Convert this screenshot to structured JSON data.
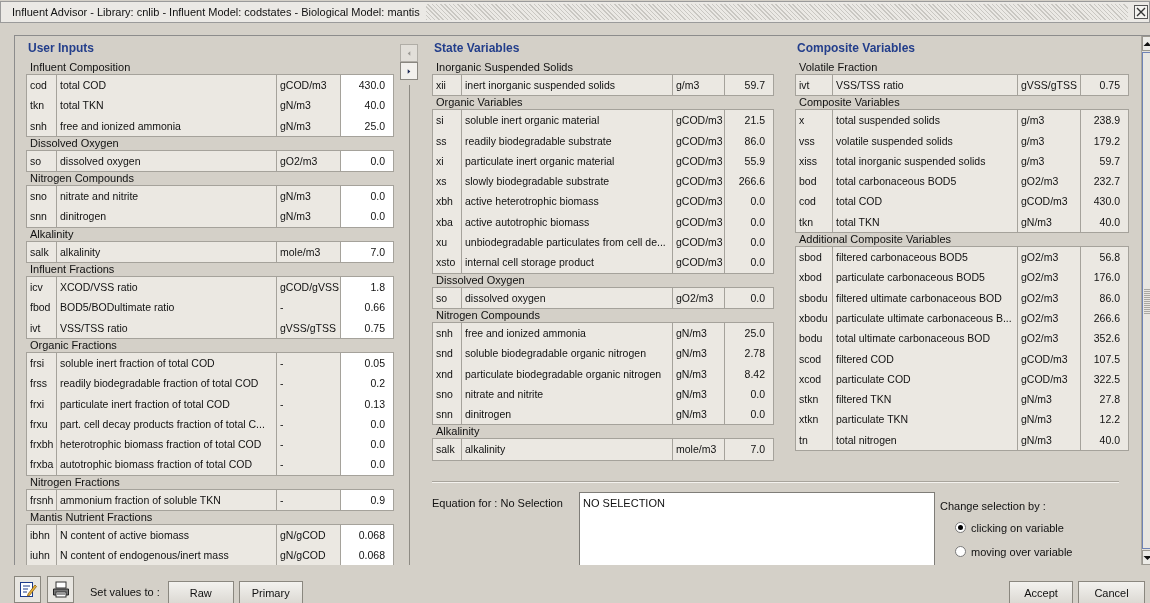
{
  "window": {
    "title": "Influent Advisor - Library: cnlib - Influent Model: codstates - Biological Model: mantis"
  },
  "user_inputs": {
    "title": "User Inputs",
    "editable": true,
    "groups": [
      {
        "title": "Influent Composition",
        "rows": [
          {
            "symbol": "cod",
            "description": "total COD",
            "unit": "gCOD/m3",
            "value": "430.0"
          },
          {
            "symbol": "tkn",
            "description": "total TKN",
            "unit": "gN/m3",
            "value": "40.0"
          },
          {
            "symbol": "snh",
            "description": "free and ionized ammonia",
            "unit": "gN/m3",
            "value": "25.0"
          }
        ]
      },
      {
        "title": "Dissolved Oxygen",
        "rows": [
          {
            "symbol": "so",
            "description": "dissolved oxygen",
            "unit": "gO2/m3",
            "value": "0.0"
          }
        ]
      },
      {
        "title": "Nitrogen Compounds",
        "rows": [
          {
            "symbol": "sno",
            "description": "nitrate and nitrite",
            "unit": "gN/m3",
            "value": "0.0"
          },
          {
            "symbol": "snn",
            "description": "dinitrogen",
            "unit": "gN/m3",
            "value": "0.0"
          }
        ]
      },
      {
        "title": "Alkalinity",
        "rows": [
          {
            "symbol": "salk",
            "description": "alkalinity",
            "unit": "mole/m3",
            "value": "7.0"
          }
        ]
      },
      {
        "title": "Influent Fractions",
        "rows": [
          {
            "symbol": "icv",
            "description": "XCOD/VSS ratio",
            "unit": "gCOD/gVSS",
            "value": "1.8"
          },
          {
            "symbol": "fbod",
            "description": "BOD5/BODultimate ratio",
            "unit": "-",
            "value": "0.66"
          },
          {
            "symbol": "ivt",
            "description": "VSS/TSS ratio",
            "unit": "gVSS/gTSS",
            "value": "0.75"
          }
        ]
      },
      {
        "title": "Organic Fractions",
        "rows": [
          {
            "symbol": "frsi",
            "description": "soluble inert fraction of total COD",
            "unit": "-",
            "value": "0.05"
          },
          {
            "symbol": "frss",
            "description": "readily biodegradable fraction of total COD",
            "unit": "-",
            "value": "0.2"
          },
          {
            "symbol": "frxi",
            "description": "particulate inert fraction of total COD",
            "unit": "-",
            "value": "0.13"
          },
          {
            "symbol": "frxu",
            "description": "part. cell decay products fraction of total C...",
            "unit": "-",
            "value": "0.0"
          },
          {
            "symbol": "frxbh",
            "description": "heterotrophic biomass fraction of total COD",
            "unit": "-",
            "value": "0.0"
          },
          {
            "symbol": "frxba",
            "description": "autotrophic biomass fraction of total COD",
            "unit": "-",
            "value": "0.0"
          }
        ]
      },
      {
        "title": "Nitrogen Fractions",
        "rows": [
          {
            "symbol": "frsnh",
            "description": "ammonium fraction of soluble TKN",
            "unit": "-",
            "value": "0.9"
          }
        ]
      },
      {
        "title": "Mantis Nutrient Fractions",
        "rows": [
          {
            "symbol": "ibhn",
            "description": "N content of active biomass",
            "unit": "gN/gCOD",
            "value": "0.068"
          },
          {
            "symbol": "iuhn",
            "description": "N content of endogenous/inert mass",
            "unit": "gN/gCOD",
            "value": "0.068"
          }
        ]
      }
    ]
  },
  "state_variables": {
    "title": "State Variables",
    "editable": false,
    "groups": [
      {
        "title": "Inorganic Suspended Solids",
        "rows": [
          {
            "symbol": "xii",
            "description": "inert inorganic suspended solids",
            "unit": "g/m3",
            "value": "59.7"
          }
        ]
      },
      {
        "title": "Organic Variables",
        "rows": [
          {
            "symbol": "si",
            "description": "soluble inert organic material",
            "unit": "gCOD/m3",
            "value": "21.5"
          },
          {
            "symbol": "ss",
            "description": "readily biodegradable substrate",
            "unit": "gCOD/m3",
            "value": "86.0"
          },
          {
            "symbol": "xi",
            "description": "particulate inert organic material",
            "unit": "gCOD/m3",
            "value": "55.9"
          },
          {
            "symbol": "xs",
            "description": "slowly biodegradable substrate",
            "unit": "gCOD/m3",
            "value": "266.6"
          },
          {
            "symbol": "xbh",
            "description": "active heterotrophic biomass",
            "unit": "gCOD/m3",
            "value": "0.0"
          },
          {
            "symbol": "xba",
            "description": "active autotrophic biomass",
            "unit": "gCOD/m3",
            "value": "0.0"
          },
          {
            "symbol": "xu",
            "description": "unbiodegradable particulates from cell de...",
            "unit": "gCOD/m3",
            "value": "0.0"
          },
          {
            "symbol": "xsto",
            "description": "internal cell storage product",
            "unit": "gCOD/m3",
            "value": "0.0"
          }
        ]
      },
      {
        "title": "Dissolved Oxygen",
        "rows": [
          {
            "symbol": "so",
            "description": "dissolved oxygen",
            "unit": "gO2/m3",
            "value": "0.0"
          }
        ]
      },
      {
        "title": "Nitrogen Compounds",
        "rows": [
          {
            "symbol": "snh",
            "description": "free and ionized ammonia",
            "unit": "gN/m3",
            "value": "25.0"
          },
          {
            "symbol": "snd",
            "description": "soluble biodegradable organic nitrogen",
            "unit": "gN/m3",
            "value": "2.78"
          },
          {
            "symbol": "xnd",
            "description": "particulate biodegradable organic nitrogen",
            "unit": "gN/m3",
            "value": "8.42"
          },
          {
            "symbol": "sno",
            "description": "nitrate and nitrite",
            "unit": "gN/m3",
            "value": "0.0"
          },
          {
            "symbol": "snn",
            "description": "dinitrogen",
            "unit": "gN/m3",
            "value": "0.0"
          }
        ]
      },
      {
        "title": "Alkalinity",
        "rows": [
          {
            "symbol": "salk",
            "description": "alkalinity",
            "unit": "mole/m3",
            "value": "7.0"
          }
        ]
      }
    ]
  },
  "composite_variables": {
    "title": "Composite Variables",
    "editable": false,
    "groups": [
      {
        "title": "Volatile Fraction",
        "rows": [
          {
            "symbol": "ivt",
            "description": "VSS/TSS ratio",
            "unit": "gVSS/gTSS",
            "value": "0.75"
          }
        ]
      },
      {
        "title": "Composite Variables",
        "rows": [
          {
            "symbol": "x",
            "description": "total suspended solids",
            "unit": "g/m3",
            "value": "238.9"
          },
          {
            "symbol": "vss",
            "description": "volatile suspended solids",
            "unit": "g/m3",
            "value": "179.2"
          },
          {
            "symbol": "xiss",
            "description": "total inorganic suspended solids",
            "unit": "g/m3",
            "value": "59.7"
          },
          {
            "symbol": "bod",
            "description": "total carbonaceous BOD5",
            "unit": "gO2/m3",
            "value": "232.7"
          },
          {
            "symbol": "cod",
            "description": "total COD",
            "unit": "gCOD/m3",
            "value": "430.0"
          },
          {
            "symbol": "tkn",
            "description": "total TKN",
            "unit": "gN/m3",
            "value": "40.0"
          }
        ]
      },
      {
        "title": "Additional Composite Variables",
        "rows": [
          {
            "symbol": "sbod",
            "description": "filtered carbonaceous BOD5",
            "unit": "gO2/m3",
            "value": "56.8"
          },
          {
            "symbol": "xbod",
            "description": "particulate carbonaceous BOD5",
            "unit": "gO2/m3",
            "value": "176.0"
          },
          {
            "symbol": "sbodu",
            "description": "filtered ultimate carbonaceous BOD",
            "unit": "gO2/m3",
            "value": "86.0"
          },
          {
            "symbol": "xbodu",
            "description": "particulate ultimate carbonaceous B...",
            "unit": "gO2/m3",
            "value": "266.6"
          },
          {
            "symbol": "bodu",
            "description": "total ultimate carbonaceous BOD",
            "unit": "gO2/m3",
            "value": "352.6"
          },
          {
            "symbol": "scod",
            "description": "filtered COD",
            "unit": "gCOD/m3",
            "value": "107.5"
          },
          {
            "symbol": "xcod",
            "description": "particulate COD",
            "unit": "gCOD/m3",
            "value": "322.5"
          },
          {
            "symbol": "stkn",
            "description": "filtered TKN",
            "unit": "gN/m3",
            "value": "27.8"
          },
          {
            "symbol": "xtkn",
            "description": "particulate TKN",
            "unit": "gN/m3",
            "value": "12.2"
          },
          {
            "symbol": "tn",
            "description": "total nitrogen",
            "unit": "gN/m3",
            "value": "40.0"
          }
        ]
      }
    ]
  },
  "equation": {
    "label": "Equation for : No Selection",
    "text": "NO SELECTION"
  },
  "selection_mode": {
    "label": "Change selection by :",
    "options": [
      {
        "label": "clicking on variable",
        "selected": true
      },
      {
        "label": "moving over variable",
        "selected": false
      }
    ]
  },
  "toolbar": {
    "label": "Set values to :",
    "buttons": [
      "Raw",
      "Primary"
    ]
  },
  "dialog_buttons": [
    "Accept",
    "Cancel"
  ]
}
